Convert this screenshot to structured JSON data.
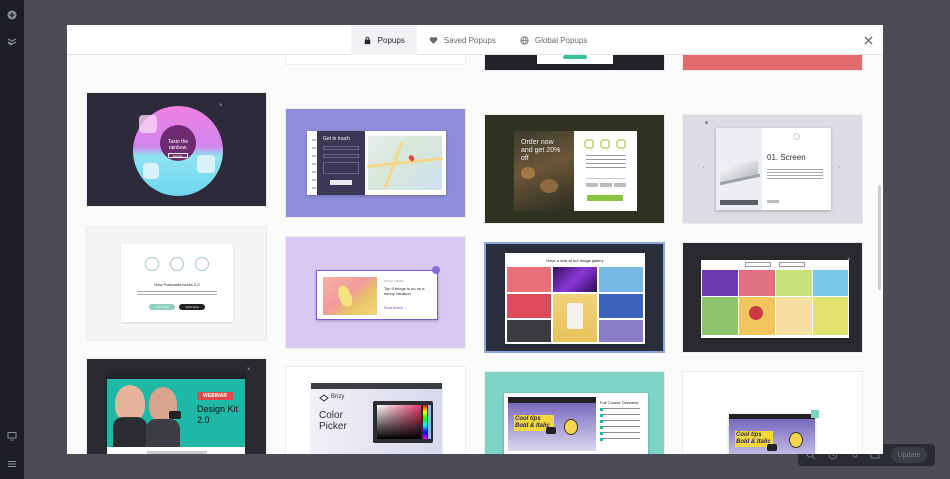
{
  "tabs": [
    {
      "label": "Popups",
      "icon": "bag-icon",
      "active": true
    },
    {
      "label": "Saved Popups",
      "icon": "heart-icon",
      "active": false
    },
    {
      "label": "Global Popups",
      "icon": "globe-icon",
      "active": false
    }
  ],
  "cards": {
    "rainbow": {
      "title": "Taste the rainbow.",
      "button": "Explore"
    },
    "contact": {
      "title": "Get in touch"
    },
    "food": {
      "headline": "Order now and get 20% off"
    },
    "screen": {
      "headline": "01. Screen"
    },
    "subscribe": {
      "heading": "How Postcards works 2.0",
      "btn1": "Get it now",
      "btn2": "Click here"
    },
    "article": {
      "kicker": "ALSO READ",
      "title": "Top 5 things to do on a sunny vacation",
      "link": "Read Article →"
    },
    "gallery": {
      "title": "Have a look at our image gallery"
    },
    "webinar": {
      "badge": "WEBINAR",
      "title": "Design Kit 2.0"
    },
    "picker": {
      "brand": "Brizy",
      "title": "Color Picker"
    },
    "course": {
      "title": "Full Course Overview",
      "video_text": "Cool tips Bold & Italic"
    },
    "video2": {
      "video_text": "Cool tips Bold & Italic"
    }
  },
  "floatbar": {
    "update_label": "Update"
  },
  "colors": {
    "accent": "#1fb7a5",
    "modal_bg": "#ffffff",
    "backdrop": "#4b4c55",
    "leftbar": "#1d1e25"
  }
}
